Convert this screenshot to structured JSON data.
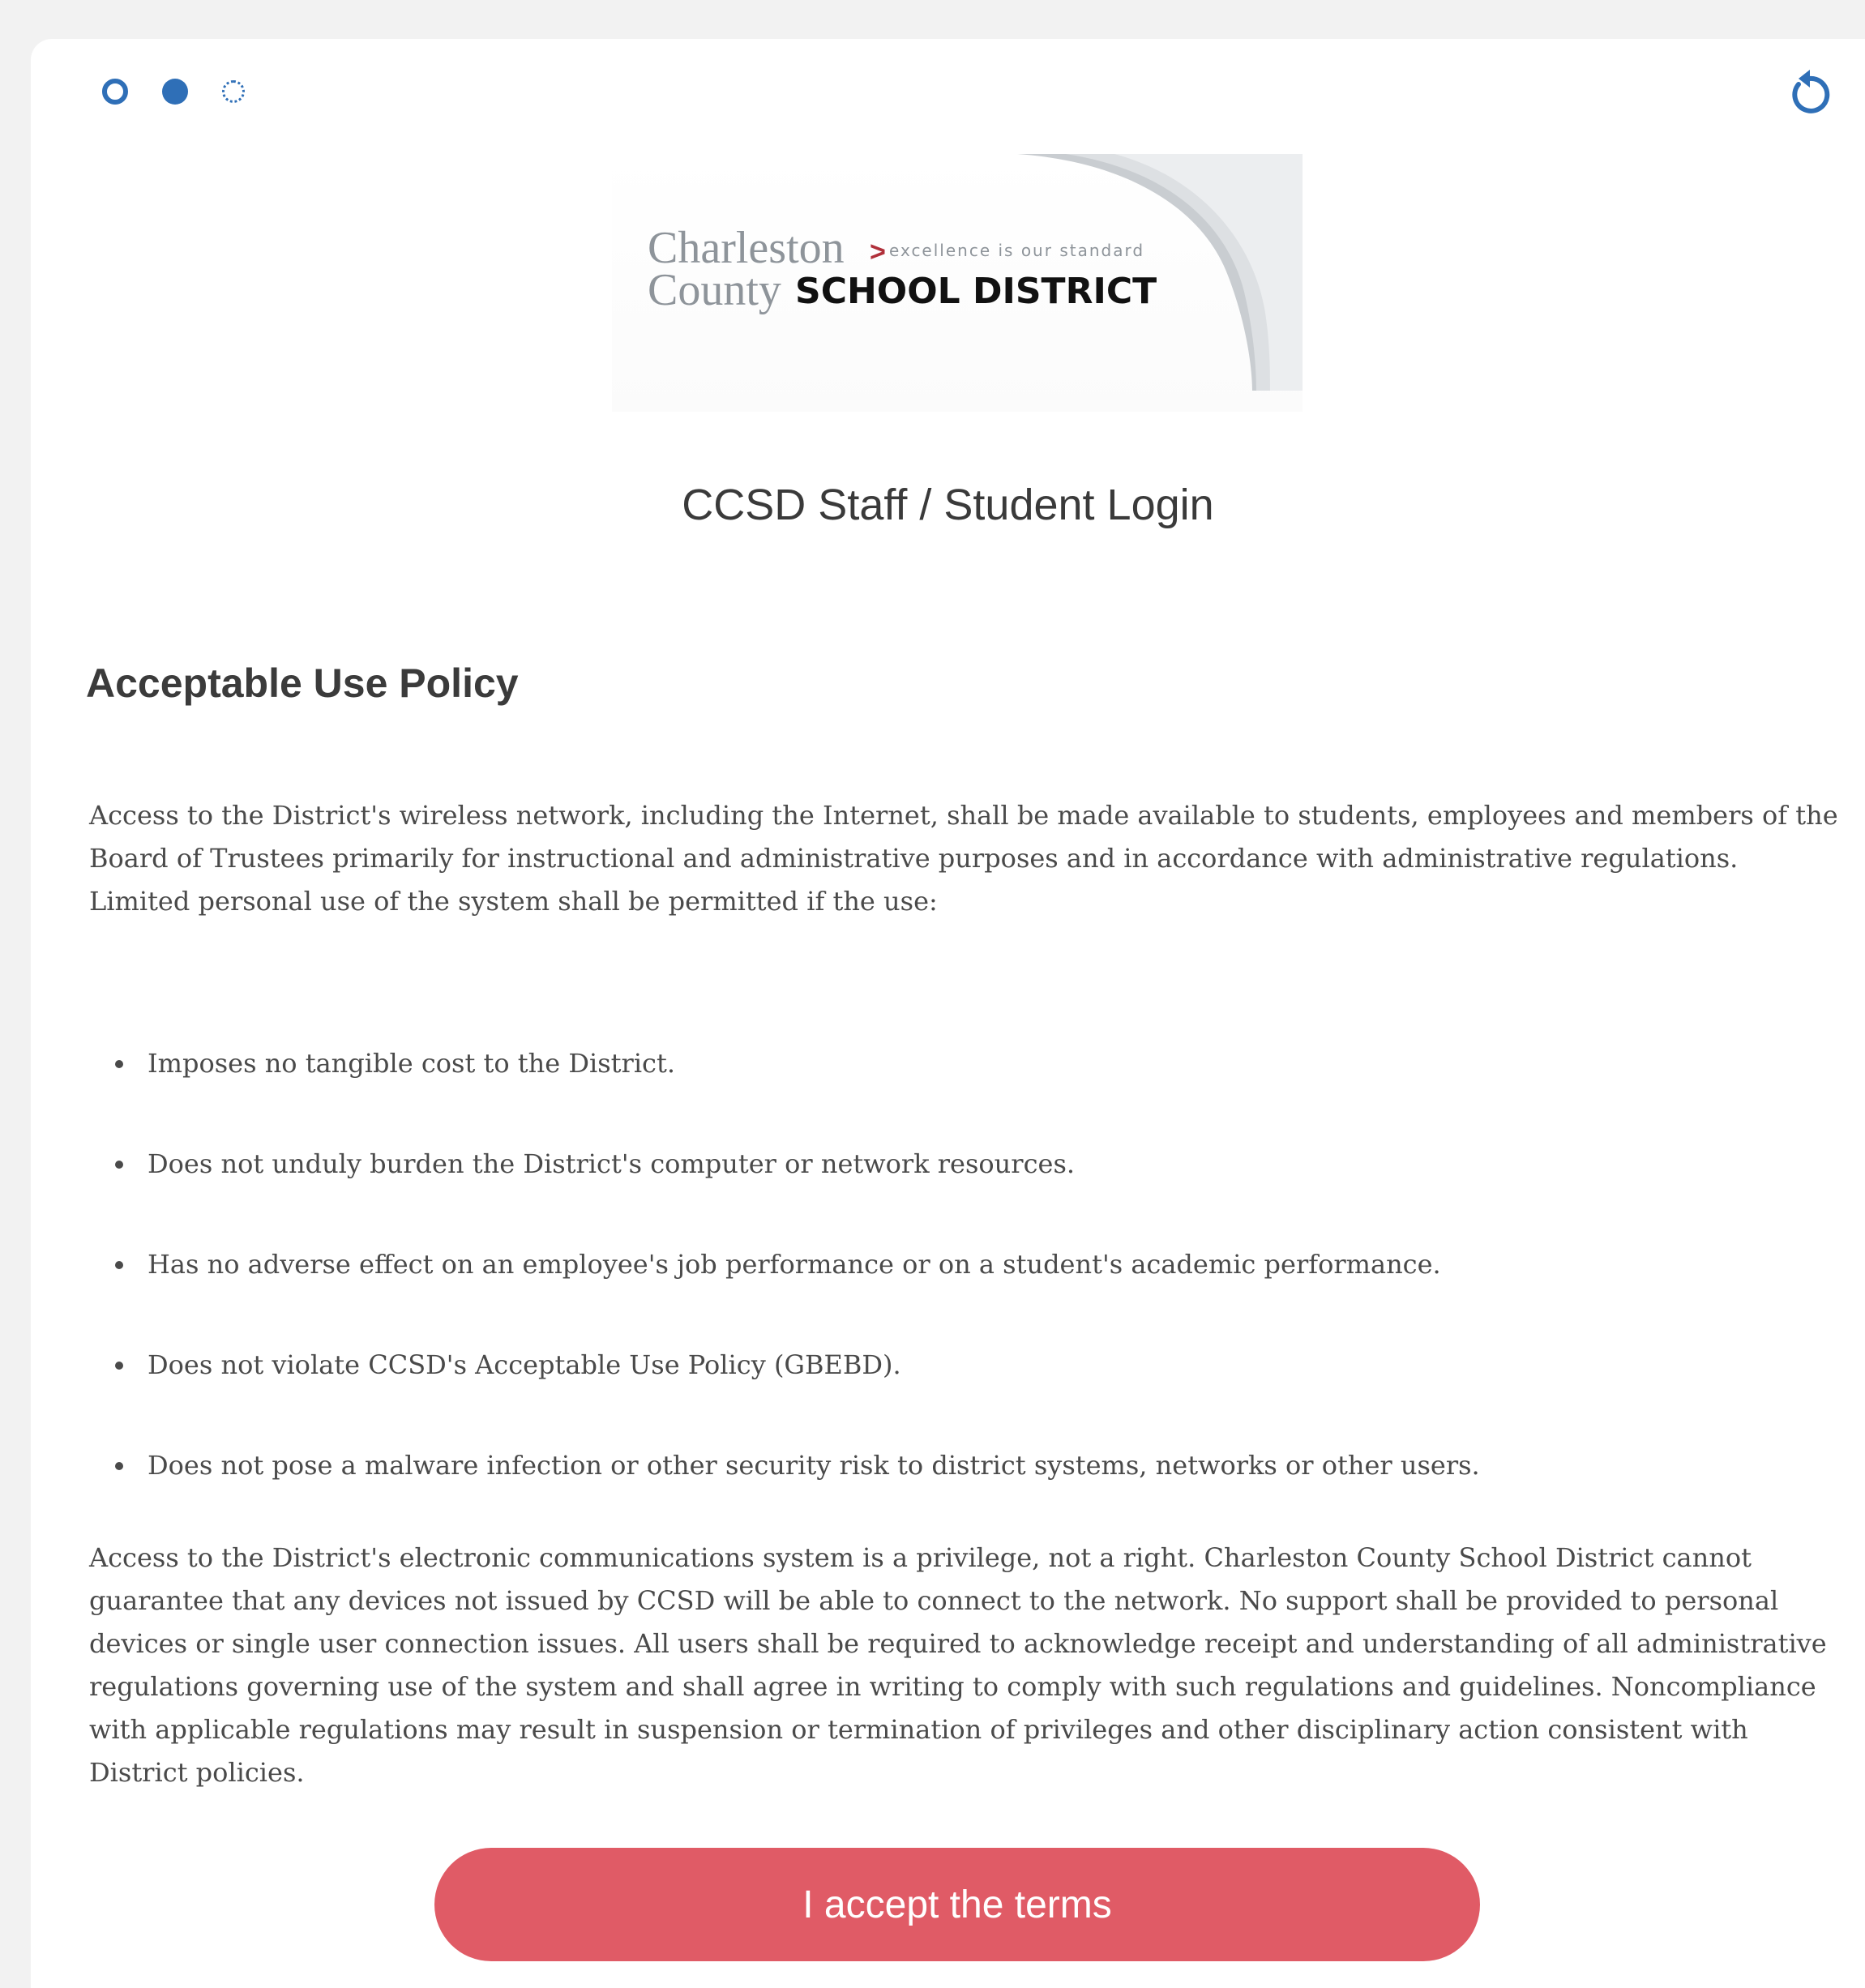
{
  "progress": {
    "steps": [
      {
        "state": "done"
      },
      {
        "state": "active"
      },
      {
        "state": "pending"
      }
    ],
    "current_step": 2,
    "total_steps": 3,
    "accent_color": "#2f6fb7"
  },
  "toolbar": {
    "reset_icon": "refresh-icon"
  },
  "logo": {
    "line1": "Charleston",
    "tagline": "excellence is our standard",
    "line2_left": "County",
    "line2_right": "SCHOOL DISTRICT"
  },
  "page_title": "CCSD Staff / Student Login",
  "policy": {
    "heading": "Acceptable Use Policy",
    "intro": "Access to the District's wireless network, including the Internet, shall be made available to students, employees and members of the Board of Trustees primarily for instructional and administrative purposes and in accordance with administrative regulations. Limited personal use of the system shall be permitted if the use:",
    "conditions": [
      "Imposes no tangible cost to the District.",
      "Does not unduly burden the District's computer or network resources.",
      "Has no adverse effect on an employee's job performance or on a student's academic performance.",
      "Does not violate CCSD's Acceptable Use Policy (GBEBD).",
      "Does not pose a malware infection or other security risk to district systems, networks or other users."
    ],
    "closing": "Access to the District's electronic communications system is a privilege, not a right. Charleston County School District cannot guarantee that any devices not issued by CCSD will be able to connect to the network. No support shall be provided to personal devices or single user connection issues. All users shall be required to acknowledge receipt and understanding of all administrative regulations governing use of the system and shall agree in writing to comply with such regulations and guidelines. Noncompliance with applicable regulations may result in suspension or termination of privileges and other disciplinary action consistent with District policies."
  },
  "accept_button": {
    "label": "I accept the terms",
    "color": "#e05b66"
  }
}
